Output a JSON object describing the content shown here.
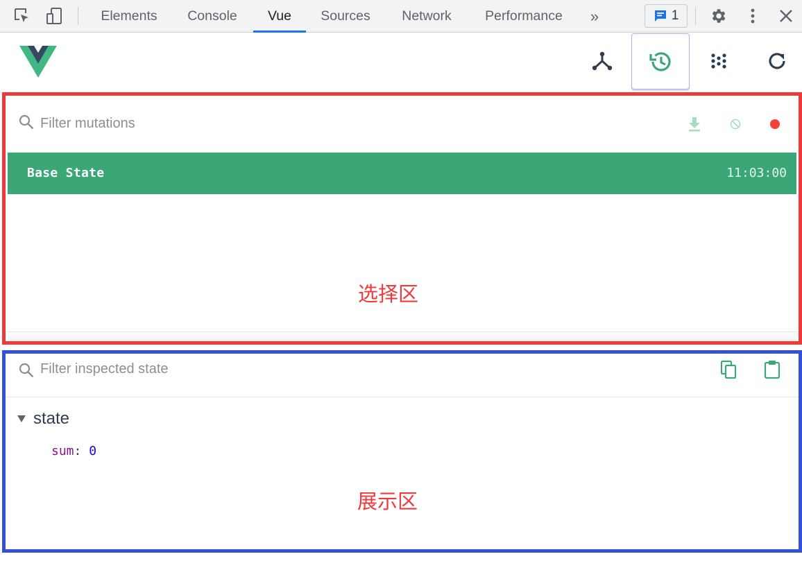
{
  "devtools": {
    "tabs": [
      {
        "label": "Elements"
      },
      {
        "label": "Console"
      },
      {
        "label": "Vue"
      },
      {
        "label": "Sources"
      },
      {
        "label": "Network"
      },
      {
        "label": "Performance"
      }
    ],
    "more_tabs_glyph": "»",
    "issues_count": "1",
    "icons": [
      "inspect-element-icon",
      "device-toolbar-icon",
      "more-tabs-icon",
      "issues-icon",
      "settings-icon",
      "kebab-menu-icon",
      "close-icon"
    ]
  },
  "vue_toolbar": {
    "icons": [
      "vue-logo",
      "components-tab-icon",
      "timeline-vuex-icon",
      "events-icon",
      "refresh-icon"
    ],
    "active_tool": "vuex-history"
  },
  "mutations": {
    "filter_placeholder": "Filter mutations",
    "actions": [
      "export-icon",
      "clear-icon",
      "record-icon"
    ],
    "items": [
      {
        "name": "Base State",
        "time": "11:03:00"
      }
    ]
  },
  "annotations": {
    "select_zone": "选择区",
    "display_zone": "展示区",
    "select_color": "#ee3a3a",
    "display_color": "#3450d8"
  },
  "inspector": {
    "filter_placeholder": "Filter inspected state",
    "actions": [
      "copy-icon",
      "paste-icon"
    ],
    "section": "state",
    "props": [
      {
        "key": "sum",
        "value": "0"
      }
    ]
  },
  "colors": {
    "vue_green": "#3ba776",
    "chrome_blue": "#1a73e8"
  }
}
